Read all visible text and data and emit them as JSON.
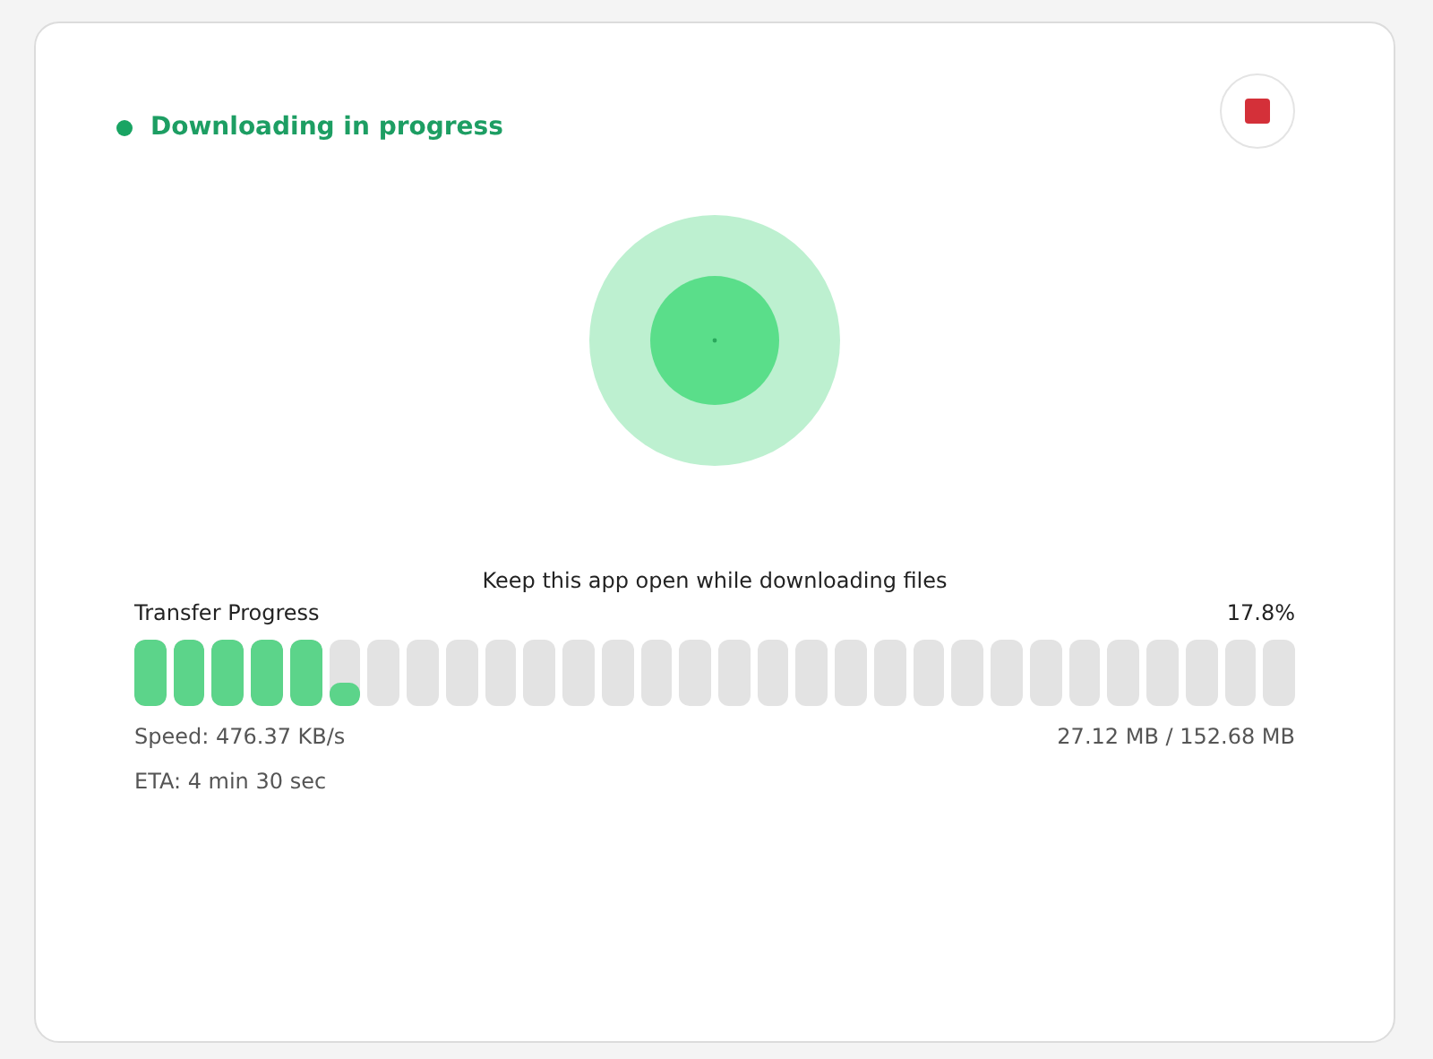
{
  "status": {
    "label": "Downloading in progress"
  },
  "notice": "Keep this app open while downloading files",
  "progress": {
    "label": "Transfer Progress",
    "percent": "17.8%",
    "level": 0.178
  },
  "speed": "Speed: 476.37 KB/s",
  "size": "27.12 MB / 152.68 MB",
  "eta": "ETA: 4 min 30 sec"
}
